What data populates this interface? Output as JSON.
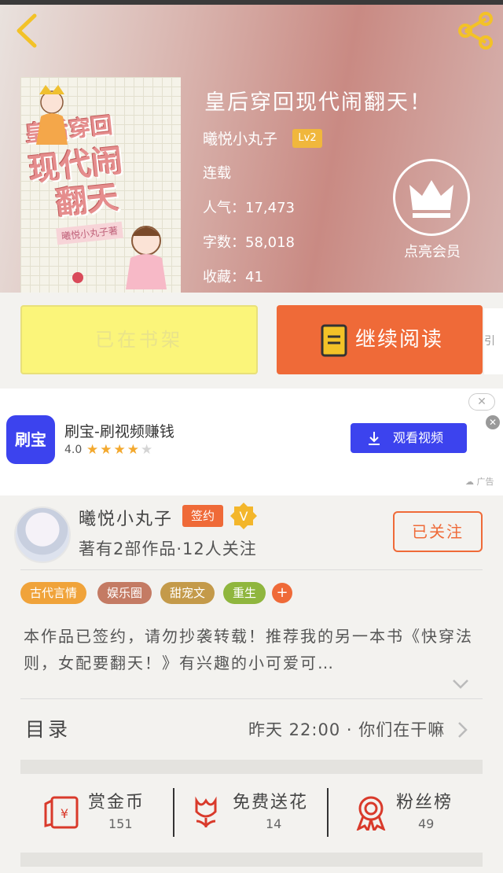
{
  "header": {
    "book_title": "皇后穿回现代闹翻天！",
    "author": "曦悦小丸子",
    "level_badge": "Lv2",
    "status": "连载",
    "popularity_label": "人气：",
    "popularity": "17,473",
    "word_count_label": "字数：",
    "word_count": "58,018",
    "favorites_label": "收藏：",
    "favorites": "41",
    "vip_label": "点亮会员",
    "cover": {
      "title_lines": [
        "皇后穿回",
        "现代闹",
        "翻天"
      ],
      "author": "曦悦小丸子著"
    }
  },
  "actions": {
    "on_shelf_label": "已在书架",
    "continue_label": "继续阅读",
    "edge_text": "引来"
  },
  "ad": {
    "logo_text": "刷宝",
    "title": "刷宝-刷视频赚钱",
    "rating": "4.0",
    "stars_on": 4,
    "stars_total": 5,
    "cta_label": "观看视频",
    "tag": "广告"
  },
  "author_card": {
    "name": "曦悦小丸子",
    "signed_badge": "签约",
    "v_badge": "V",
    "stats": "著有2部作品·12人关注",
    "follow_label": "已关注"
  },
  "tags": [
    {
      "label": "古代言情",
      "color": "#f0a33a"
    },
    {
      "label": "娱乐圈",
      "color": "#c47b64"
    },
    {
      "label": "甜宠文",
      "color": "#c49a4a"
    },
    {
      "label": "重生",
      "color": "#8fb63e"
    }
  ],
  "synopsis": "本作品已签约，请勿抄袭转载！推荐我的另一本书《快穿法则，女配要翻天！》有兴趣的小可爱可…",
  "catalog": {
    "label": "目录",
    "latest": "昨天 22:00 · 你们在干嘛"
  },
  "stats": [
    {
      "label": "赏金币",
      "value": "151",
      "icon": "red-envelope-icon"
    },
    {
      "label": "免费送花",
      "value": "14",
      "icon": "flower-icon"
    },
    {
      "label": "粉丝榜",
      "value": "49",
      "icon": "medal-icon"
    }
  ],
  "colors": {
    "accent": "#ef6a38",
    "shelf_button": "#fbf57a",
    "ad_blue": "#3c43ee",
    "icon_red": "#d93a2b"
  }
}
